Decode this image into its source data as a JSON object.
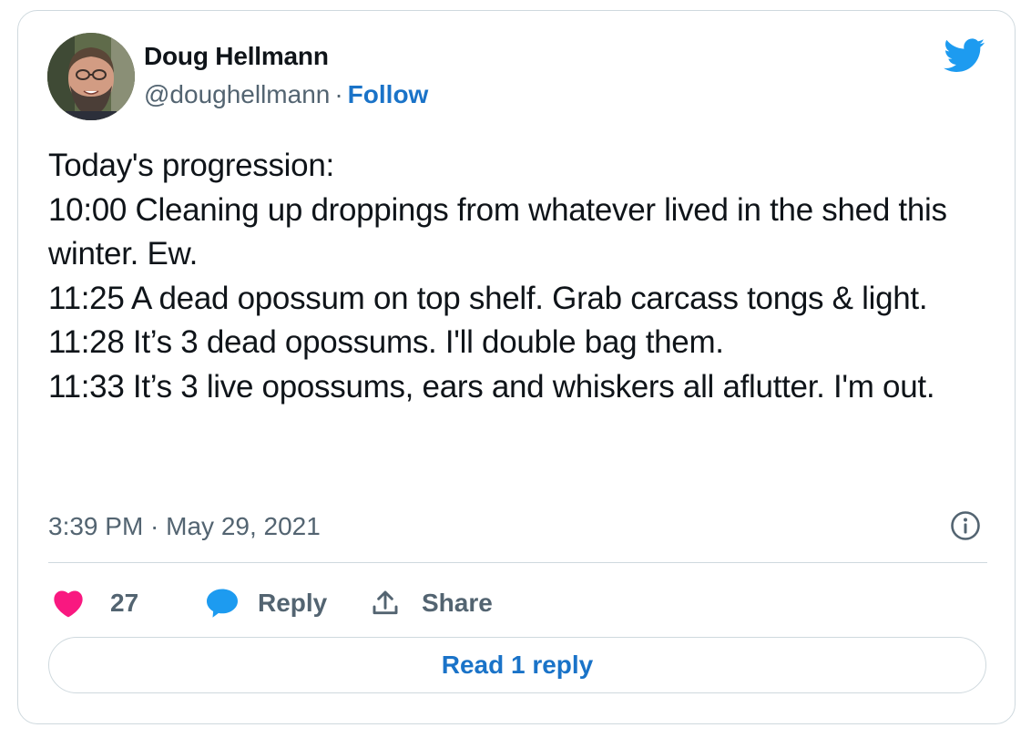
{
  "author": {
    "name": "Doug Hellmann",
    "handle": "@doughellmann",
    "separator": "·",
    "follow_label": "Follow"
  },
  "tweet": {
    "lines": [
      "Today's progression:",
      "10:00 Cleaning up droppings from whatever lived in the shed this winter. Ew.",
      "11:25 A dead opossum on top shelf. Grab carcass tongs & light.",
      "11:28 It’s 3 dead opossums. I'll double bag them.",
      "11:33 It’s 3 live opossums, ears and whiskers all aflutter. I'm out."
    ],
    "timestamp": "3:39 PM · May 29, 2021"
  },
  "actions": {
    "like_count": "27",
    "reply_label": "Reply",
    "share_label": "Share"
  },
  "read_reply_label": "Read 1 reply",
  "icons": {
    "brand": "twitter-bird-icon",
    "info": "info-icon",
    "like": "heart-icon",
    "reply": "speech-bubble-icon",
    "share": "share-upload-icon"
  },
  "colors": {
    "twitter_blue": "#1d9bf0",
    "link_blue": "#1a73c8",
    "heart_pink": "#f91880",
    "muted_text": "#536471",
    "border": "#cfd9de"
  }
}
